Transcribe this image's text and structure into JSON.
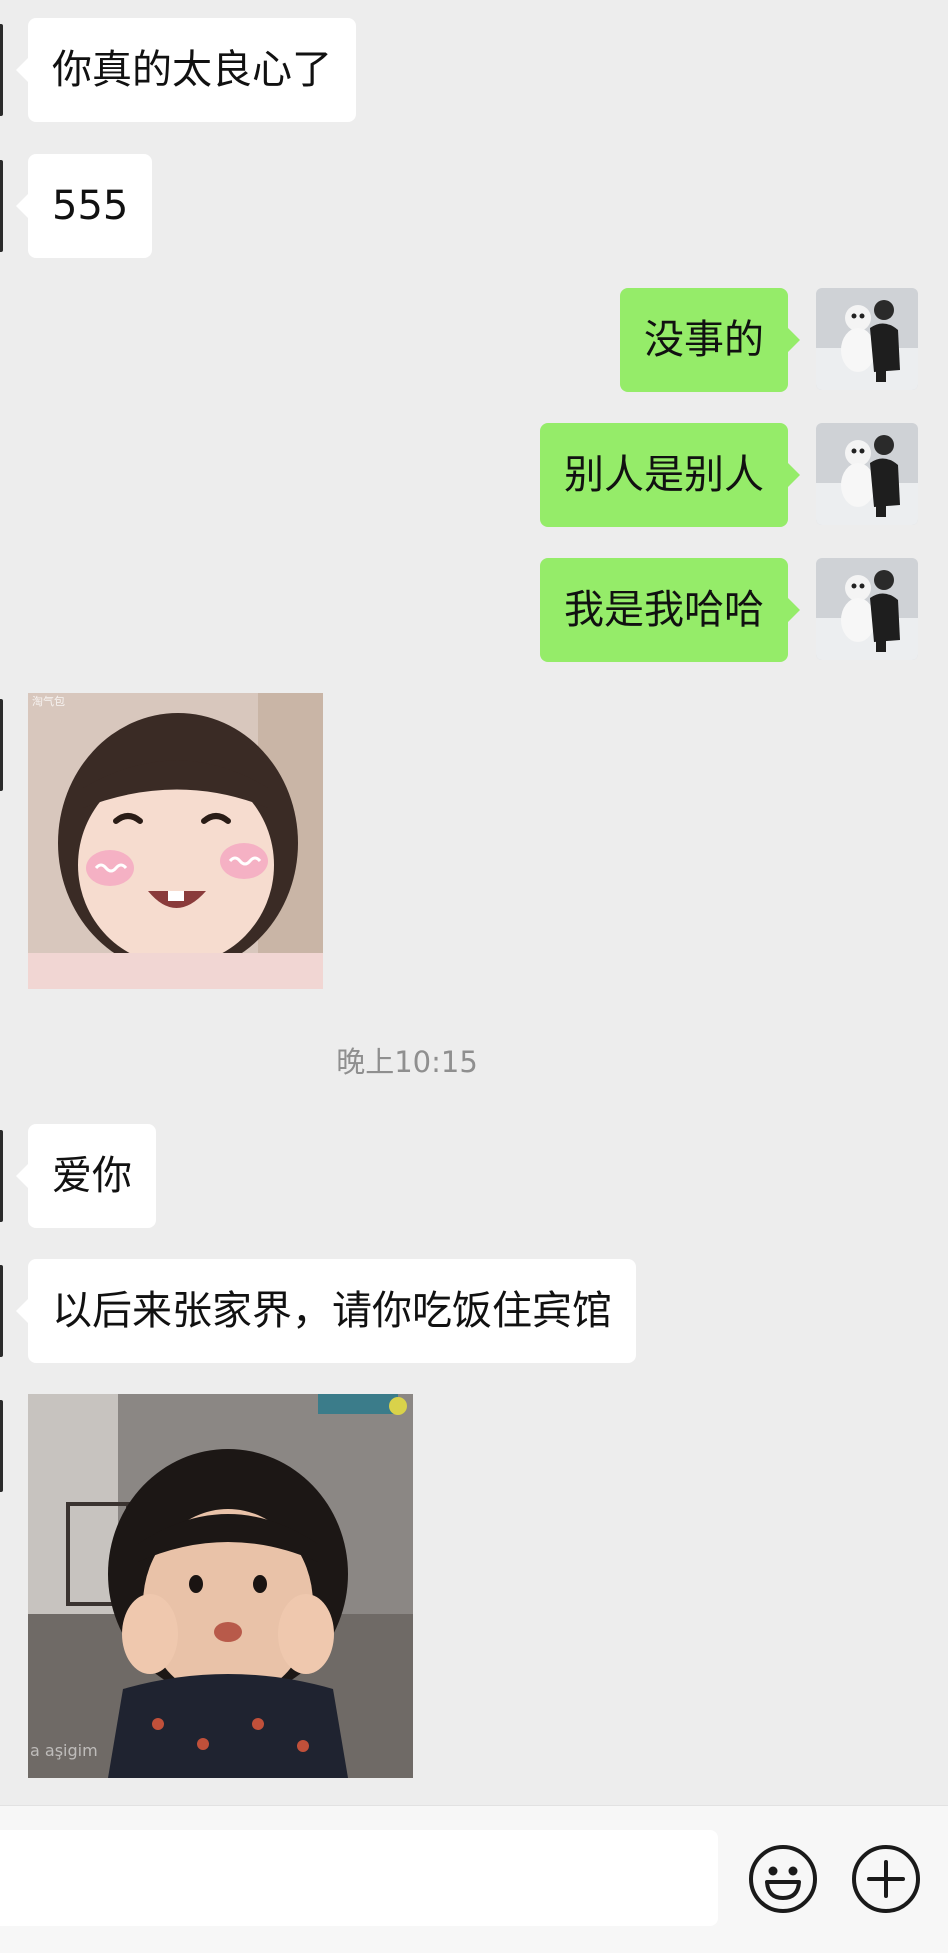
{
  "messages": {
    "m1": "你真的太良心了",
    "m2": "555",
    "m3": "没事的",
    "m4": "别人是别人",
    "m5": "我是我哈哈",
    "m6": "爱你",
    "m7": "以后来张家界，请你吃饭住宾馆"
  },
  "timestamp": "晚上10:15",
  "stickers": {
    "s1_watermark": "淘气包",
    "s2_watermark": "a aşigim"
  },
  "input_bar": {
    "value": "",
    "emoji_icon": "smiley-face-icon",
    "plus_icon": "plus-circle-icon"
  },
  "colors": {
    "background": "#ededed",
    "incoming_bubble": "#ffffff",
    "outgoing_bubble": "#95ec69",
    "timestamp_text": "#8f8f8f"
  }
}
